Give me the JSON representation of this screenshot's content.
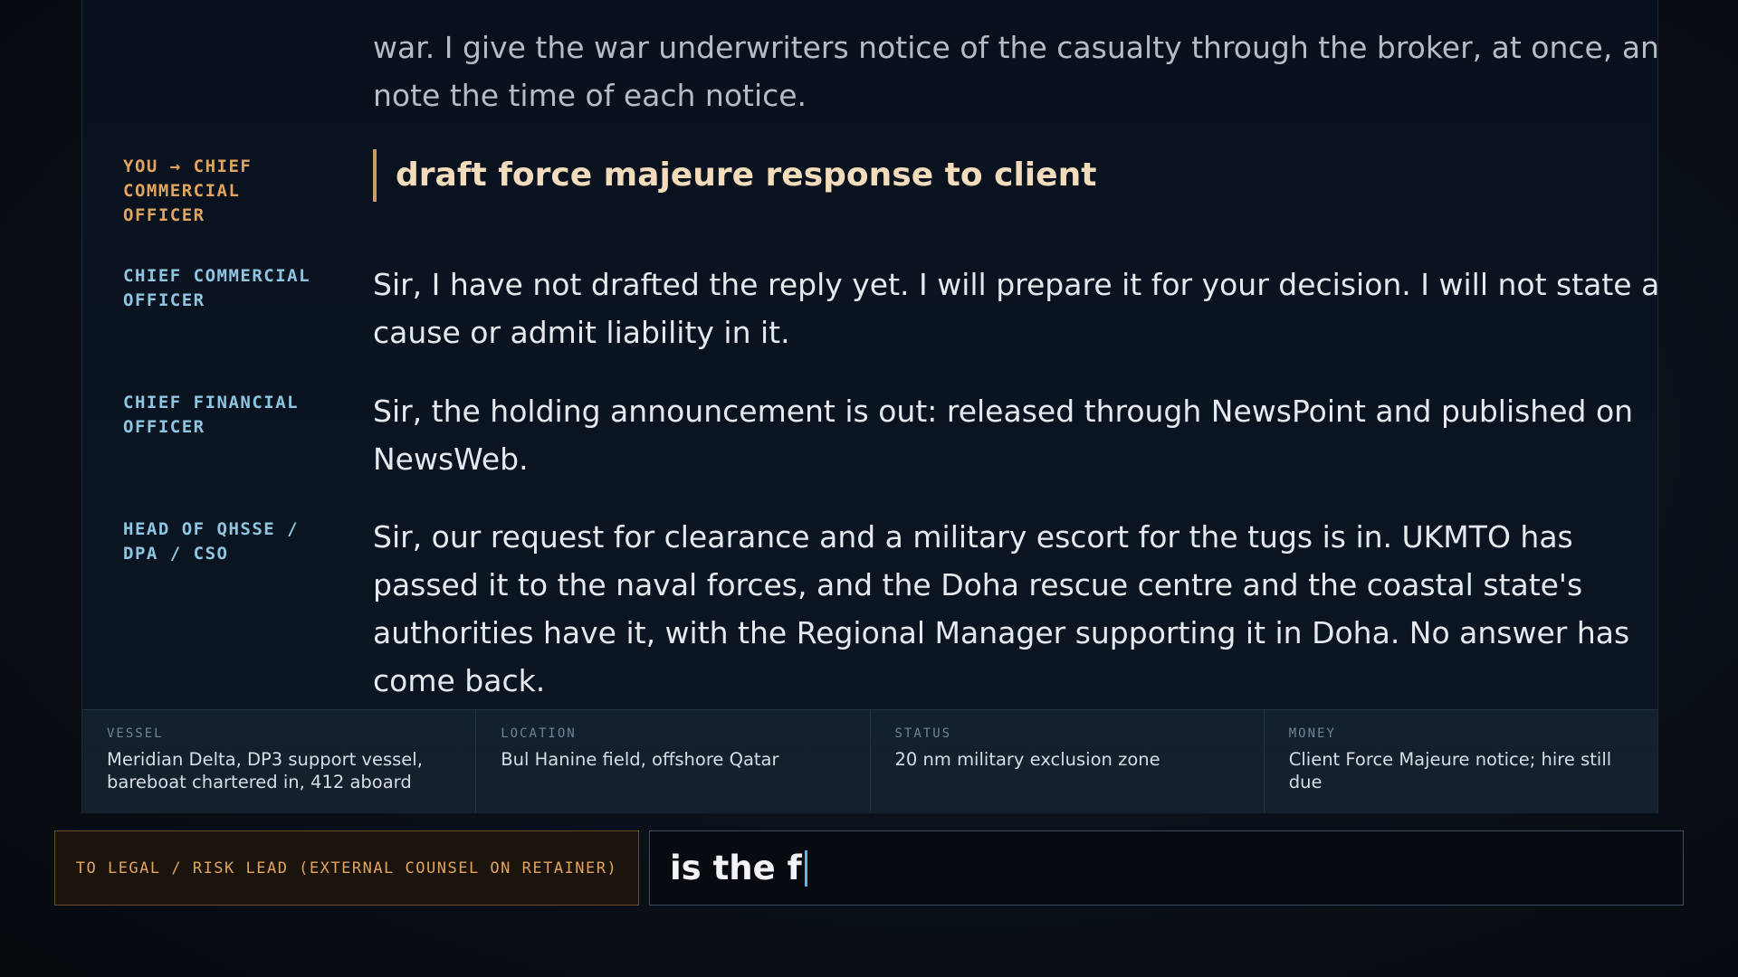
{
  "transcript": {
    "entries": [
      {
        "speaker": "",
        "kind": "reply-faded",
        "text": "war. I give the war underwriters notice of the casualty through the broker, at once, and note the time of each notice."
      },
      {
        "speaker": "YOU → CHIEF COMMERCIAL OFFICER",
        "kind": "command",
        "text": "draft force majeure response to client"
      },
      {
        "speaker": "CHIEF COMMERCIAL OFFICER",
        "kind": "reply",
        "text": "Sir, I have not drafted the reply yet. I will prepare it for your decision. I will not state a cause or admit liability in it."
      },
      {
        "speaker": "CHIEF FINANCIAL OFFICER",
        "kind": "reply",
        "text": "Sir, the holding announcement is out: released through NewsPoint and published on NewsWeb."
      },
      {
        "speaker": "HEAD OF QHSSE / DPA / CSO",
        "kind": "reply",
        "text": "Sir, our request for clearance and a military escort for the tugs is in. UKMTO has passed it to the naval forces, and the Doha rescue centre and the coastal state's authorities have it, with the Regional Manager supporting it in Doha. No answer has come back."
      }
    ]
  },
  "status_bar": {
    "vessel": {
      "label": "VESSEL",
      "value": "Meridian Delta, DP3 support vessel, bareboat chartered in, 412 aboard"
    },
    "location": {
      "label": "LOCATION",
      "value": "Bul Hanine field, offshore Qatar"
    },
    "status": {
      "label": "STATUS",
      "value": "20 nm military exclusion zone"
    },
    "money": {
      "label": "MONEY",
      "value": "Client Force Majeure notice; hire still due"
    }
  },
  "composer": {
    "recipient": "TO LEGAL / RISK LEAD (EXTERNAL COUNSEL ON RETAINER)",
    "input_value": "is the f"
  },
  "colors": {
    "accent_amber": "#e0a45e",
    "speaker_blue": "#8ec5e0",
    "caret_blue": "#5fb7e8"
  }
}
